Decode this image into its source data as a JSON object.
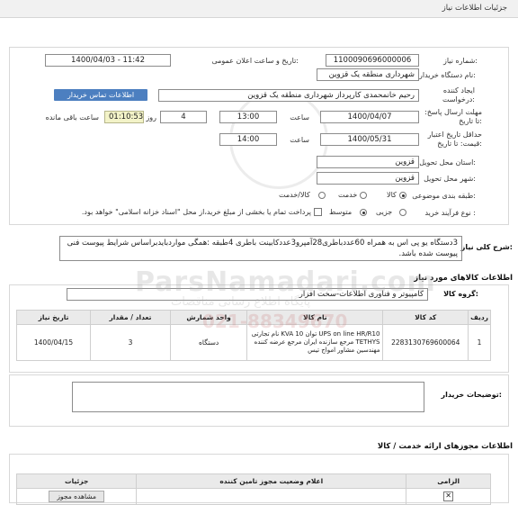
{
  "header": {
    "title": "جزئیات اطلاعات نیاز"
  },
  "form": {
    "need_number_label": "شماره نیاز:",
    "need_number": "1100090696000006",
    "announce_label": "تاریخ و ساعت اعلان عمومی:",
    "announce_value": "1400/04/03 - 11:42",
    "buyer_org_label": "نام دستگاه خریدار:",
    "buyer_org": "شهرداری منطقه یک قزوین",
    "creator_label": "ایجاد کننده درخواست:",
    "creator": "رحیم خانمحمدی کارپرداز شهرداری منطقه یک قزوین",
    "contact_button": "اطلاعات تماس خریدار",
    "deadline_label": "مهلت ارسال پاسخ: تا تاریخ:",
    "deadline_date": "1400/04/07",
    "time_label": "ساعت",
    "deadline_time": "13:00",
    "days_value": "4",
    "days_label": "روز و",
    "remaining_time": "01:10:53",
    "remaining_label": "ساعت باقی مانده",
    "validity_label": "حداقل تاریخ اعتبار قیمت: تا تاریخ:",
    "validity_date": "1400/05/31",
    "validity_time_label": "ساعت",
    "validity_time": "14:00",
    "province_label": "استان محل تحویل:",
    "province": "قزوین",
    "city_label": "شهر محل تحویل:",
    "city": "قزوین",
    "category_label": "طبقه بندی موضوعی:",
    "category_options": [
      "کالا",
      "خدمت",
      "کالا/خدمت"
    ],
    "category_selected": "کالا",
    "process_label": "نوع فرآیند خرید :",
    "process_options": [
      "جزیی",
      "متوسط"
    ],
    "process_selected": "متوسط",
    "payment_note": "پرداخت تمام یا بخشی از مبلغ خرید،از محل \"اسناد خزانه اسلامی\" خواهد بود."
  },
  "description": {
    "label": "شرح کلی نیاز:",
    "text": "3دستگاه یو پی اس به همراه 60عددباطری28آمپرو3عددکابینت باطری 4طبقه :همگی مواردبایدبراساس شرایط پیوست فنی پیوست شده باشد."
  },
  "goods": {
    "section_title": "اطلاعات کالاهای مورد نیاز",
    "group_label": "گروه کالا:",
    "group_value": "کامپیوتر و فناوری اطلاعات-سخت افزار",
    "columns": [
      "ردیف",
      "کد کالا",
      "نام کالا",
      "واحد شمارش",
      "تعداد / مقدار",
      "تاریخ نیاز"
    ],
    "rows": [
      {
        "row": "1",
        "code": "2283130769600064",
        "name": "UPS on line HR/R10 توان KVA 10 نام تجارتی TETHYS مرجع سازنده ایران مرجع عرضه کننده مهندسین مشاور امواج تیس",
        "unit": "دستگاه",
        "qty": "3",
        "date": "1400/04/15"
      }
    ]
  },
  "buyer_notes": {
    "label": "توضیحات خریدار:"
  },
  "permits": {
    "section_title": "اطلاعات مجوزهای ارائه خدمت / کالا",
    "columns": [
      "الزامی",
      "اعلام وضعیت مجوز تامین کننده",
      "جزئیات"
    ],
    "view_button": "مشاهده مجوز"
  },
  "watermark": {
    "brand": "ParsNamadari.com",
    "sub": "پایگاه اطلاع رسانی مناقصات",
    "phone": "021-88349670"
  }
}
